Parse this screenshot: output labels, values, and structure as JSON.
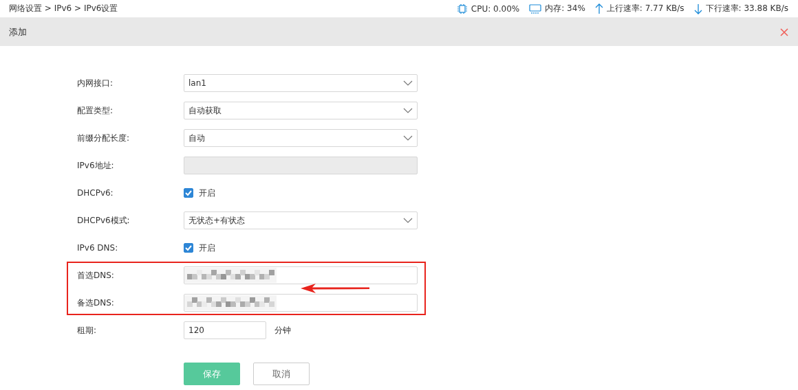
{
  "breadcrumb": "网络设置 > IPv6 > IPv6设置",
  "status": [
    {
      "kind": "cpu",
      "text": "CPU: 0.00%"
    },
    {
      "kind": "memory",
      "text": "内存: 34%"
    },
    {
      "kind": "upload",
      "text": "上行速率: 7.77 KB/s"
    },
    {
      "kind": "download",
      "text": "下行速率: 33.88 KB/s"
    }
  ],
  "dialog": {
    "title": "添加"
  },
  "form": [
    {
      "kind": "select",
      "label": "内网接口:",
      "value": "lan1"
    },
    {
      "kind": "select",
      "label": "配置类型:",
      "value": "自动获取"
    },
    {
      "kind": "select",
      "label": "前缀分配长度:",
      "value": "自动"
    },
    {
      "kind": "input",
      "label": "IPv6地址:",
      "disabled": true
    },
    {
      "kind": "checkbox",
      "label": "DHCPv6:",
      "checked": true,
      "text": "开启"
    },
    {
      "kind": "select",
      "label": "DHCPv6模式:",
      "value": "无状态+有状态"
    },
    {
      "kind": "checkbox",
      "label": "IPv6 DNS:",
      "checked": true,
      "text": "开启"
    },
    {
      "kind": "redacted",
      "label": "首选DNS:",
      "highlighted": true
    },
    {
      "kind": "redacted",
      "label": "备选DNS:",
      "highlighted": true
    },
    {
      "kind": "unit",
      "label": "租期:",
      "value": "120",
      "unit": "分钟"
    }
  ],
  "buttons": [
    {
      "kind": "primary",
      "label": "保存"
    },
    {
      "kind": "secondary",
      "label": "取消"
    }
  ]
}
